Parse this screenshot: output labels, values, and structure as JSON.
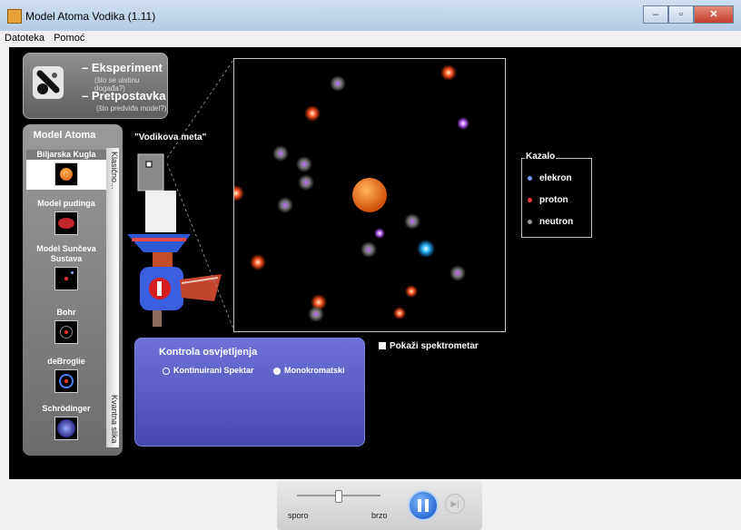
{
  "window": {
    "title": "Model Atoma Vodika (1.11)",
    "controls": [
      "–",
      "▫",
      "✕"
    ]
  },
  "menu": {
    "items": [
      "Datoteka",
      "Pomoć"
    ]
  },
  "experiment_panel": {
    "experiment_label": "– Eksperiment",
    "experiment_sub": "(što se uistinu događa?)",
    "prediction_label": "– Pretpostavka",
    "prediction_sub": "(što predviđa model?)"
  },
  "model_panel": {
    "title": "Model Atoma",
    "classic_label": "Klasično...",
    "quantum_label": "Kvantna slika",
    "models": [
      {
        "label": "Biljarska Kugla",
        "selected": true
      },
      {
        "label": "Model pudinga",
        "selected": false
      },
      {
        "label": "Model Sunčeva Sustava",
        "selected": false
      },
      {
        "label": "Bohr",
        "selected": false
      },
      {
        "label": "deBroglie",
        "selected": false
      },
      {
        "label": "Schrödinger",
        "selected": false
      }
    ]
  },
  "target_label": "\"Vodikova meta\"",
  "legend": {
    "title": "Kazalo",
    "items": [
      {
        "label": "elekron",
        "color": "#7f9cff"
      },
      {
        "label": "proton",
        "color": "#ff3b3b"
      },
      {
        "label": "neutron",
        "color": "#9a9a9a"
      }
    ]
  },
  "spectrometer": {
    "label": "Pokaži spektrometar",
    "checked": true
  },
  "light_control": {
    "title": "Kontrola osvjetljenja",
    "options": [
      {
        "label": "Kontinuirani Spektar",
        "selected": false
      },
      {
        "label": "Monokromatski",
        "selected": true
      }
    ]
  },
  "playback": {
    "slow_label": "sporo",
    "fast_label": "brzo",
    "speed": 0.55
  }
}
